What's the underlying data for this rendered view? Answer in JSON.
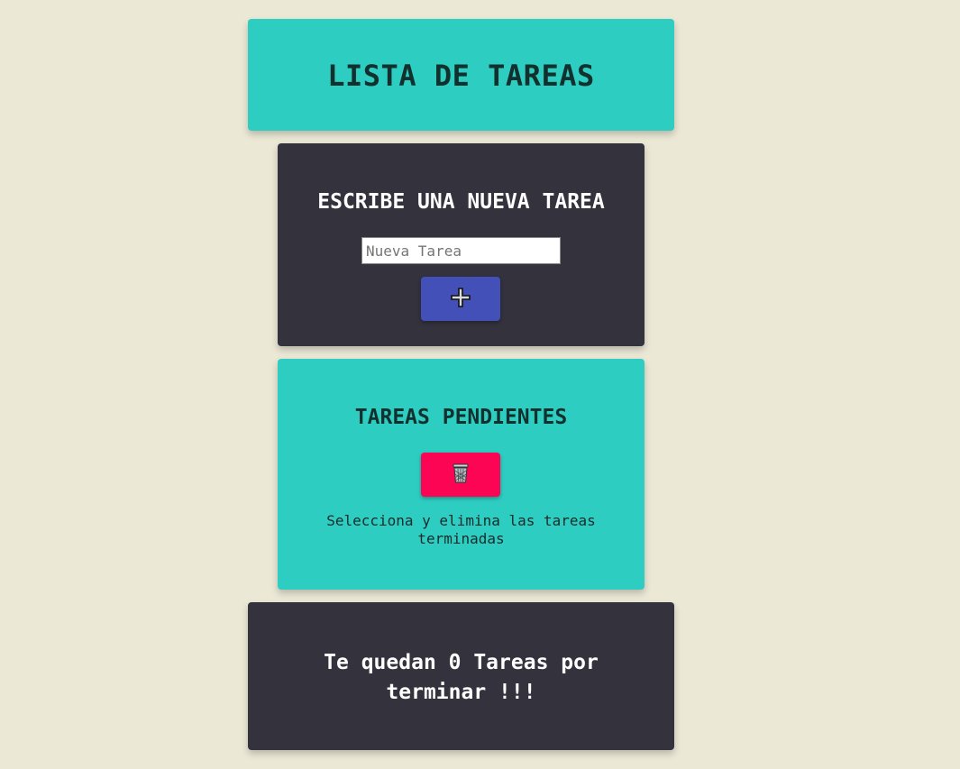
{
  "header": {
    "title": "LISTA DE TAREAS"
  },
  "new_task": {
    "heading": "ESCRIBE UNA NUEVA TAREA",
    "input_placeholder": "Nueva Tarea",
    "input_value": "",
    "add_icon": "plus-icon"
  },
  "pending": {
    "heading": "TAREAS PENDIENTES",
    "delete_icon": "trash-icon",
    "hint": "Selecciona y elimina las tareas terminadas"
  },
  "counter": {
    "text": "Te quedan 0 Tareas por terminar !!!"
  },
  "colors": {
    "background": "#ebe8d6",
    "teal": "#2ecdc1",
    "dark": "#33323d",
    "add_button": "#4350b8",
    "delete_button": "#fc0554"
  }
}
